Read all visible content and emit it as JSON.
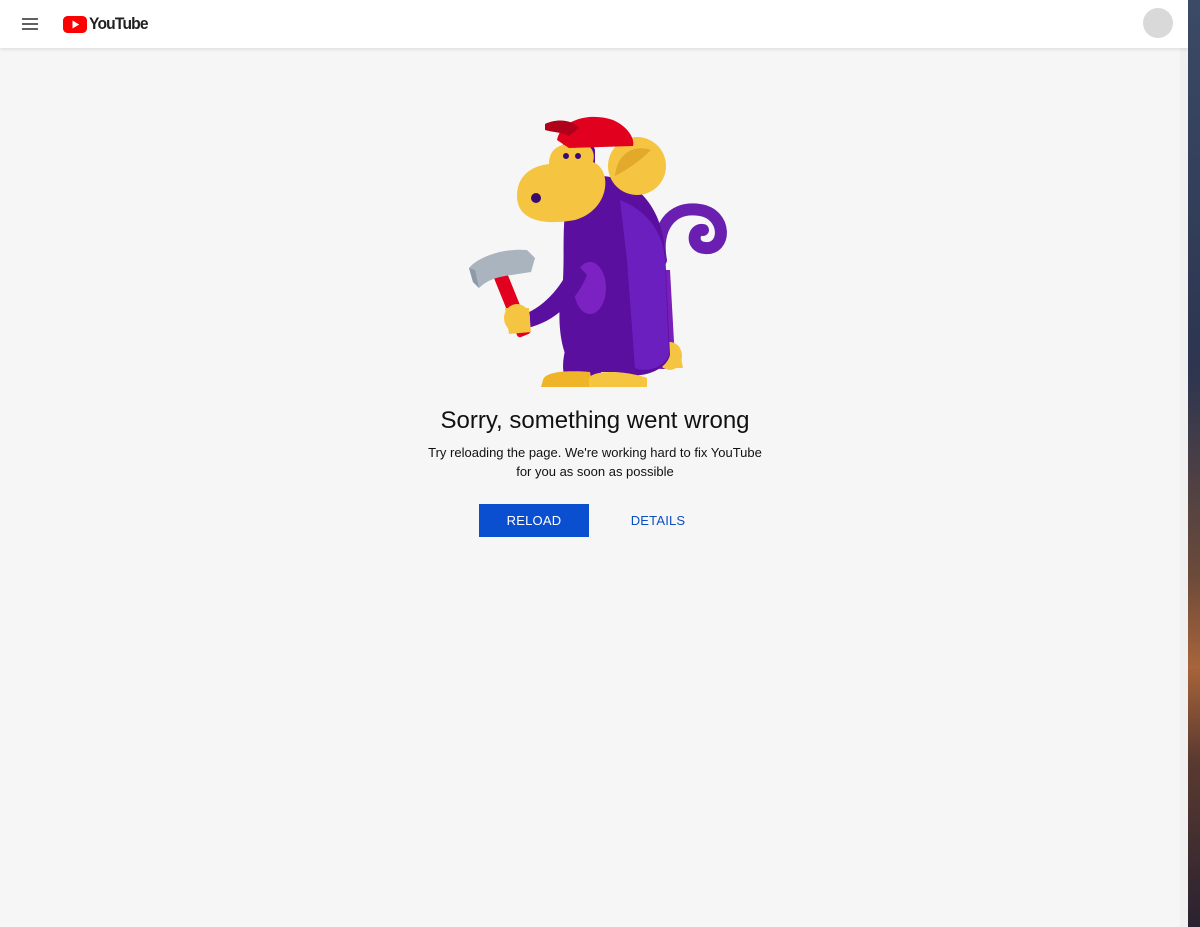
{
  "masthead": {
    "menu_icon": "hamburger-menu-icon",
    "logo_icon": "youtube-play-icon",
    "logo_text": "YouTube",
    "avatar_icon": "account-avatar-icon"
  },
  "error": {
    "illustration": "monkey-with-hammer-icon",
    "title": "Sorry, something went wrong",
    "message_line1": "Try reloading the page. We're working hard to fix YouTube",
    "message_line2": "for you as soon as possible",
    "reload_label": "RELOAD",
    "details_label": "DETAILS"
  },
  "colors": {
    "brand_red": "#ff0000",
    "primary_button": "#0b4fd1",
    "link_blue": "#0b4fbf",
    "page_background": "#f6f6f6",
    "monkey_purple": "#5b0f9e",
    "monkey_yellow": "#f5c542",
    "cap_red": "#e1001e"
  }
}
